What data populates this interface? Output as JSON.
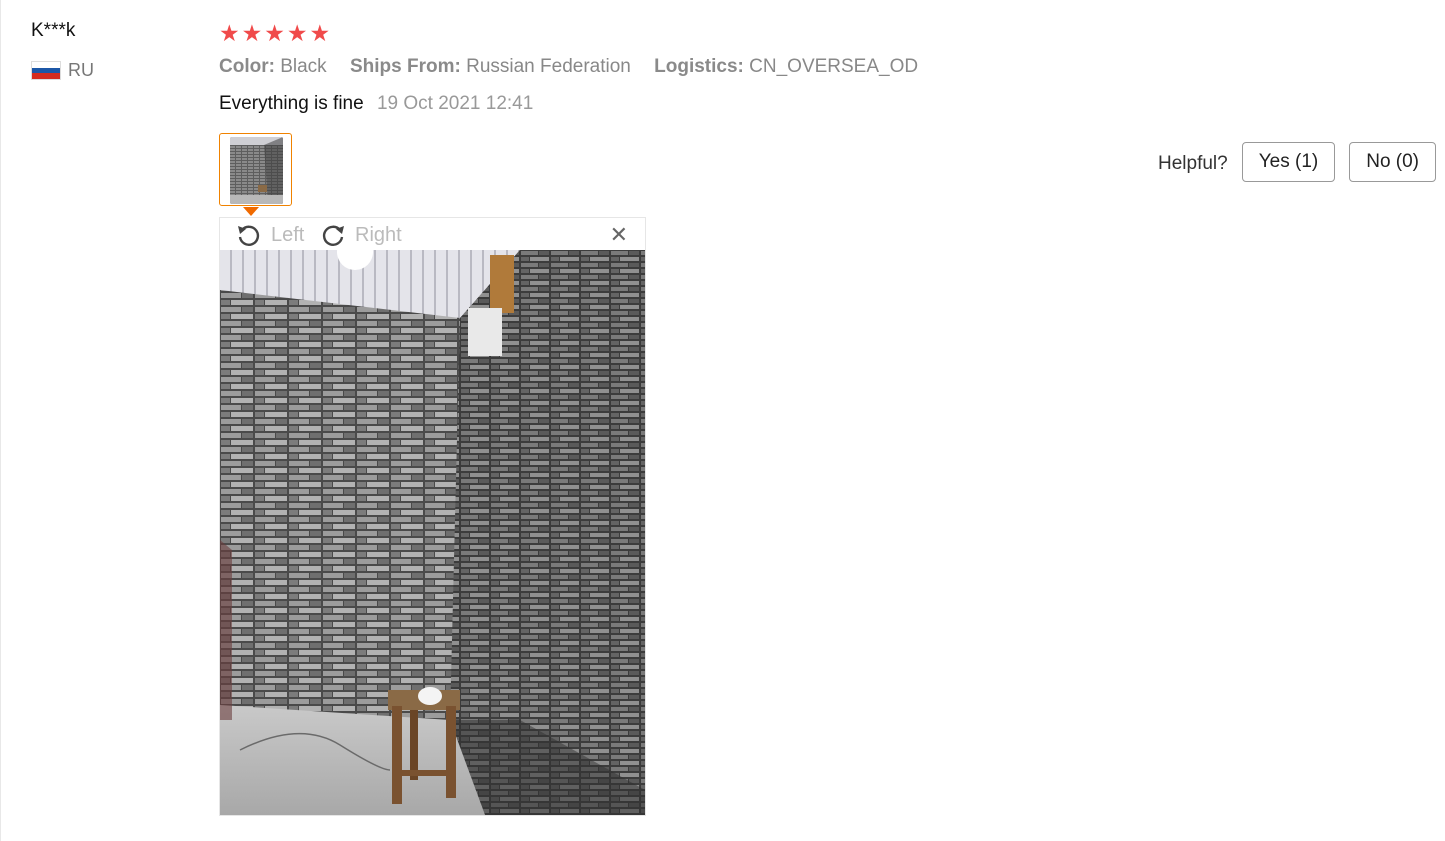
{
  "review": {
    "user_name": "K***k",
    "country_code": "RU",
    "rating": 5,
    "attributes": [
      {
        "key": "Color:",
        "value": "Black"
      },
      {
        "key": "Ships From:",
        "value": "Russian Federation"
      },
      {
        "key": "Logistics:",
        "value": "CN_OVERSEA_OD"
      }
    ],
    "text": "Everything is fine",
    "date": "19 Oct 2021 12:41"
  },
  "viewer": {
    "rotate_left_label": "Left",
    "rotate_right_label": "Right"
  },
  "helpful": {
    "label": "Helpful?",
    "yes_label": "Yes (1)",
    "no_label": "No (0)"
  },
  "colors": {
    "star": "#f04a4a",
    "thumb_border": "#f08200",
    "flag": [
      "#ffffff",
      "#1c57a7",
      "#d52b1e"
    ]
  },
  "icons": {
    "rating": "star-icon",
    "rotate_left": "rotate-left-icon",
    "rotate_right": "rotate-right-icon",
    "close": "close-icon"
  }
}
